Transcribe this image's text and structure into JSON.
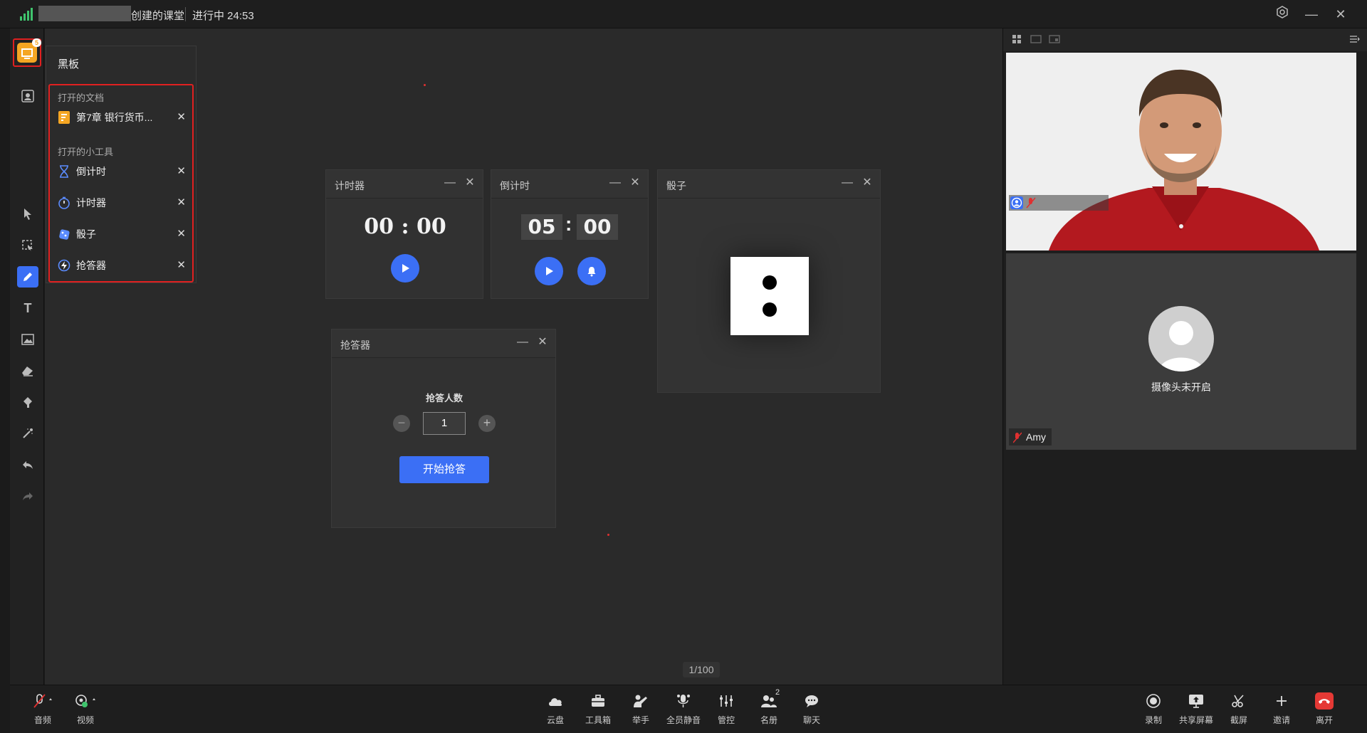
{
  "titlebar": {
    "room_name": "创建的课堂",
    "status": "进行中 24:53"
  },
  "blackboard": {
    "badge": "5",
    "title": "黑板",
    "documents_section": "打开的文档",
    "documents": [
      {
        "label": "第7章 银行货币...",
        "icon": "document-icon"
      }
    ],
    "tools_section": "打开的小工具",
    "tools": [
      {
        "label": "倒计时",
        "icon": "hourglass-icon"
      },
      {
        "label": "计时器",
        "icon": "stopwatch-icon"
      },
      {
        "label": "骰子",
        "icon": "dice-icon"
      },
      {
        "label": "抢答器",
        "icon": "buzzer-icon"
      }
    ],
    "close_glyph": "✕"
  },
  "widgets": {
    "stopwatch": {
      "title": "计时器",
      "time": "00 : 00"
    },
    "countdown": {
      "title": "倒计时",
      "minutes": "05",
      "colon": ":",
      "seconds": "00"
    },
    "dice": {
      "title": "骰子",
      "face_value": 2
    },
    "buzzer": {
      "title": "抢答器",
      "count_label": "抢答人数",
      "count_value": "1",
      "start_label": "开始抢答"
    }
  },
  "canvas": {
    "page_indicator": "1/100"
  },
  "participants": [
    {
      "name": "",
      "camera": "on",
      "mic": "muted"
    },
    {
      "name": "Amy",
      "camera_off_text": "摄像头未开启",
      "mic": "muted"
    }
  ],
  "bottombar": {
    "left": [
      {
        "label": "音频",
        "icon": "mic-muted-icon"
      },
      {
        "label": "视频",
        "icon": "camera-icon"
      }
    ],
    "center": [
      {
        "label": "云盘",
        "icon": "cloud-icon"
      },
      {
        "label": "工具箱",
        "icon": "toolbox-icon"
      },
      {
        "label": "举手",
        "icon": "raise-hand-icon"
      },
      {
        "label": "全员静音",
        "icon": "mute-all-icon"
      },
      {
        "label": "管控",
        "icon": "controls-icon"
      },
      {
        "label": "名册",
        "icon": "roster-icon",
        "count": "2"
      },
      {
        "label": "聊天",
        "icon": "chat-icon"
      }
    ],
    "right": [
      {
        "label": "录制",
        "icon": "record-icon"
      },
      {
        "label": "共享屏幕",
        "icon": "share-screen-icon"
      },
      {
        "label": "截屏",
        "icon": "screenshot-icon"
      },
      {
        "label": "邀请",
        "icon": "invite-icon"
      },
      {
        "label": "离开",
        "icon": "leave-icon"
      }
    ]
  },
  "colors": {
    "accent": "#3b6ff5",
    "highlight_border": "#e02020",
    "blackboard_icon": "#f5a623",
    "leave": "#e53935"
  }
}
